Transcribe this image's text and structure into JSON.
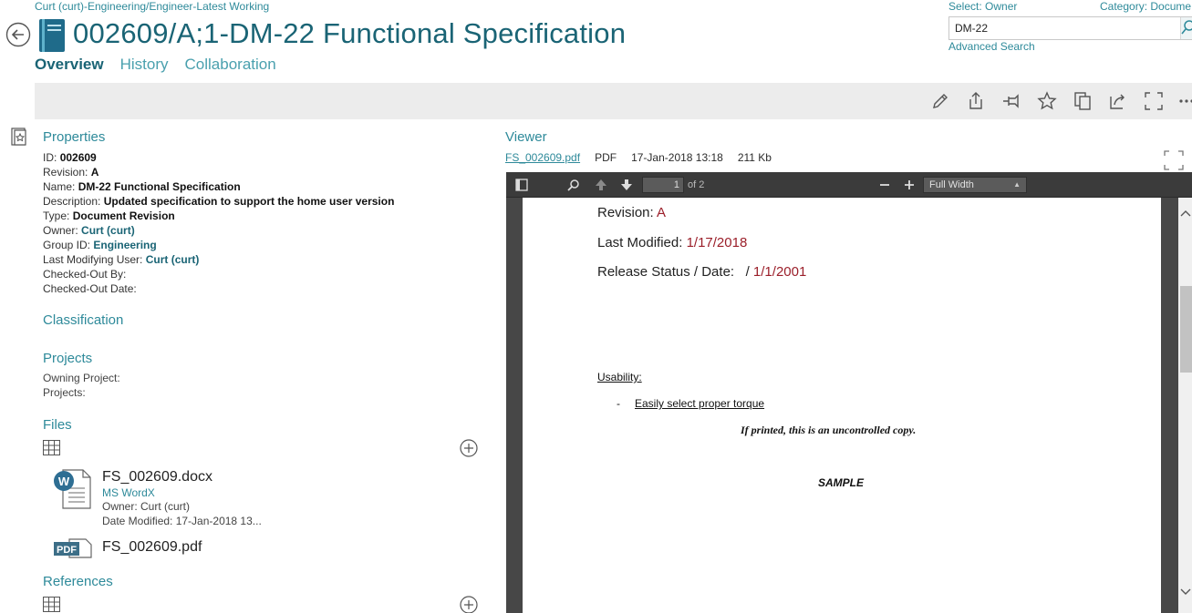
{
  "context": "Curt (curt)-Engineering/Engineer-Latest Working",
  "title": "002609/A;1-DM-22 Functional Specification",
  "tabs": [
    "Overview",
    "History",
    "Collaboration"
  ],
  "search": {
    "select_owner": "Select: Owner",
    "category": "Category: Docume",
    "value": "DM-22",
    "advanced": "Advanced Search"
  },
  "toolbar_icons": [
    "pencil-icon",
    "share-icon",
    "pin-icon",
    "star-icon",
    "copy-icon",
    "export-icon",
    "fullscreen-icon",
    "more-icon"
  ],
  "properties": {
    "heading": "Properties",
    "items": [
      {
        "label": "ID:",
        "value": "002609",
        "link": false
      },
      {
        "label": "Revision:",
        "value": "A",
        "link": false
      },
      {
        "label": "Name:",
        "value": "DM-22 Functional Specification",
        "link": false
      },
      {
        "label": "Description:",
        "value": "Updated specification to support the home user version",
        "link": false
      },
      {
        "label": "Type:",
        "value": "Document Revision",
        "link": false
      },
      {
        "label": "Owner:",
        "value": "Curt (curt)",
        "link": true
      },
      {
        "label": "Group ID:",
        "value": "Engineering",
        "link": true
      },
      {
        "label": "Last Modifying User:",
        "value": "Curt (curt)",
        "link": true
      },
      {
        "label": "Checked-Out By:",
        "value": "",
        "link": false
      },
      {
        "label": "Checked-Out Date:",
        "value": "",
        "link": false
      }
    ]
  },
  "classification": {
    "heading": "Classification"
  },
  "projects": {
    "heading": "Projects",
    "owning": "Owning Project:",
    "projects": "Projects:"
  },
  "files": {
    "heading": "Files",
    "items": [
      {
        "name": "FS_002609.docx",
        "app": "MS WordX",
        "owner": "Owner:  Curt (curt)",
        "modified": "Date Modified:  17-Jan-2018 13..."
      },
      {
        "name": "FS_002609.pdf"
      }
    ]
  },
  "references": {
    "heading": "References"
  },
  "viewer": {
    "heading": "Viewer",
    "file": "FS_002609.pdf",
    "type": "PDF",
    "date": "17-Jan-2018 13:18",
    "size": "211 Kb",
    "page": "1",
    "of": "of 2",
    "zoom": "Full Width",
    "revision_label": "Revision: ",
    "revision_value": "A",
    "modified_label": "Last Modified: ",
    "modified_value": "1/17/2018",
    "release_label": "Release Status / Date:   / ",
    "release_value": "1/1/2001",
    "usability": "Usability:",
    "dash": "-",
    "bullet": "Easily select proper torque",
    "uncontrolled": "If printed, this is an uncontrolled copy.",
    "sample": "SAMPLE"
  },
  "colors": {
    "accent": "#2e8a9a",
    "title": "#1a6475",
    "red": "#9b1f2a"
  }
}
